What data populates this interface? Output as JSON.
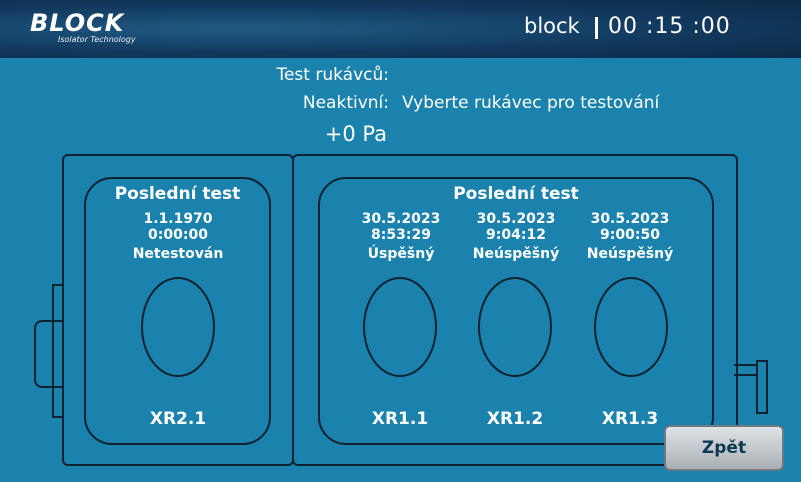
{
  "header": {
    "logo_word": "BLOCK",
    "logo_sub": "Isolator Technology",
    "user": "block",
    "time": "00 :15 :00"
  },
  "info": {
    "test_label": "Test rukávců:",
    "state_label": "Neaktivní:",
    "state_value": "Vyberte rukávec pro testování",
    "pressure": "+0 Pa"
  },
  "left_section": {
    "title": "Poslední test",
    "ports": [
      {
        "date": "1.1.1970",
        "time": "0:00:00",
        "status": "Netestován",
        "label": "XR2.1"
      }
    ]
  },
  "right_section": {
    "title": "Poslední test",
    "ports": [
      {
        "date": "30.5.2023",
        "time": "8:53:29",
        "status": "Úspěšný",
        "label": "XR1.1"
      },
      {
        "date": "30.5.2023",
        "time": "9:04:12",
        "status": "Neúspěšný",
        "label": "XR1.2"
      },
      {
        "date": "30.5.2023",
        "time": "9:00:50",
        "status": "Neúspěšný",
        "label": "XR1.3"
      }
    ]
  },
  "buttons": {
    "back": "Zpět"
  },
  "colors": {
    "background": "#1a82ad",
    "header": "#123a5e",
    "outline": "#0e2230"
  }
}
